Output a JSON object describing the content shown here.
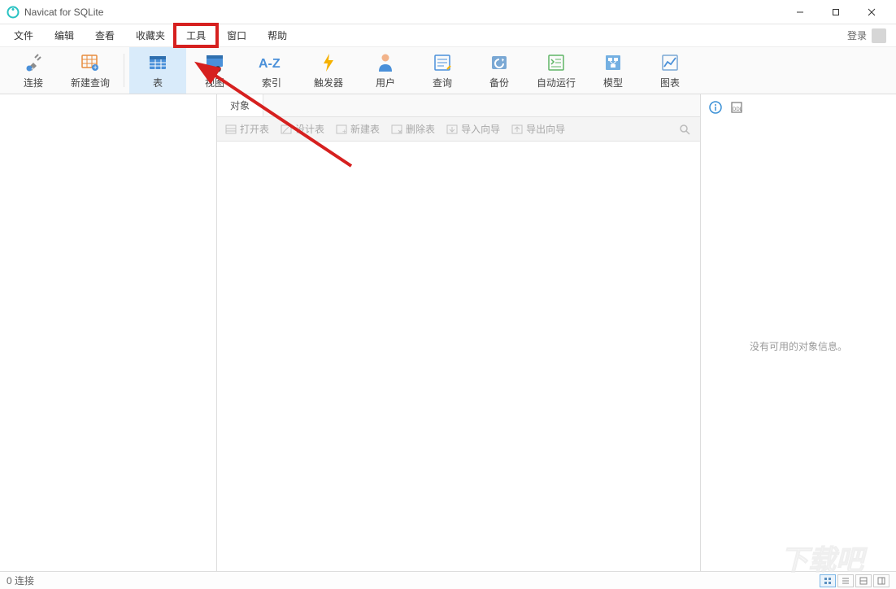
{
  "app": {
    "title": "Navicat for SQLite"
  },
  "menu": {
    "items": [
      "文件",
      "编辑",
      "查看",
      "收藏夹",
      "工具",
      "窗口",
      "帮助"
    ],
    "highlighted_index": 4,
    "login_label": "登录"
  },
  "toolbar": {
    "items": [
      {
        "label": "连接",
        "icon": "plug"
      },
      {
        "label": "新建查询",
        "icon": "grid-plus"
      }
    ],
    "items2": [
      {
        "label": "表",
        "icon": "table",
        "selected": true
      },
      {
        "label": "视图",
        "icon": "view"
      },
      {
        "label": "索引",
        "icon": "az"
      },
      {
        "label": "触发器",
        "icon": "bolt"
      },
      {
        "label": "用户",
        "icon": "user"
      },
      {
        "label": "查询",
        "icon": "query"
      },
      {
        "label": "备份",
        "icon": "backup"
      },
      {
        "label": "自动运行",
        "icon": "auto"
      },
      {
        "label": "模型",
        "icon": "model"
      },
      {
        "label": "图表",
        "icon": "chart"
      }
    ]
  },
  "center": {
    "tab_label": "对象",
    "actions": [
      "打开表",
      "设计表",
      "新建表",
      "删除表",
      "导入向导",
      "导出向导"
    ]
  },
  "right": {
    "no_info": "没有可用的对象信息。"
  },
  "status": {
    "text": "0 连接"
  },
  "watermark": {
    "text": "下载吧"
  }
}
